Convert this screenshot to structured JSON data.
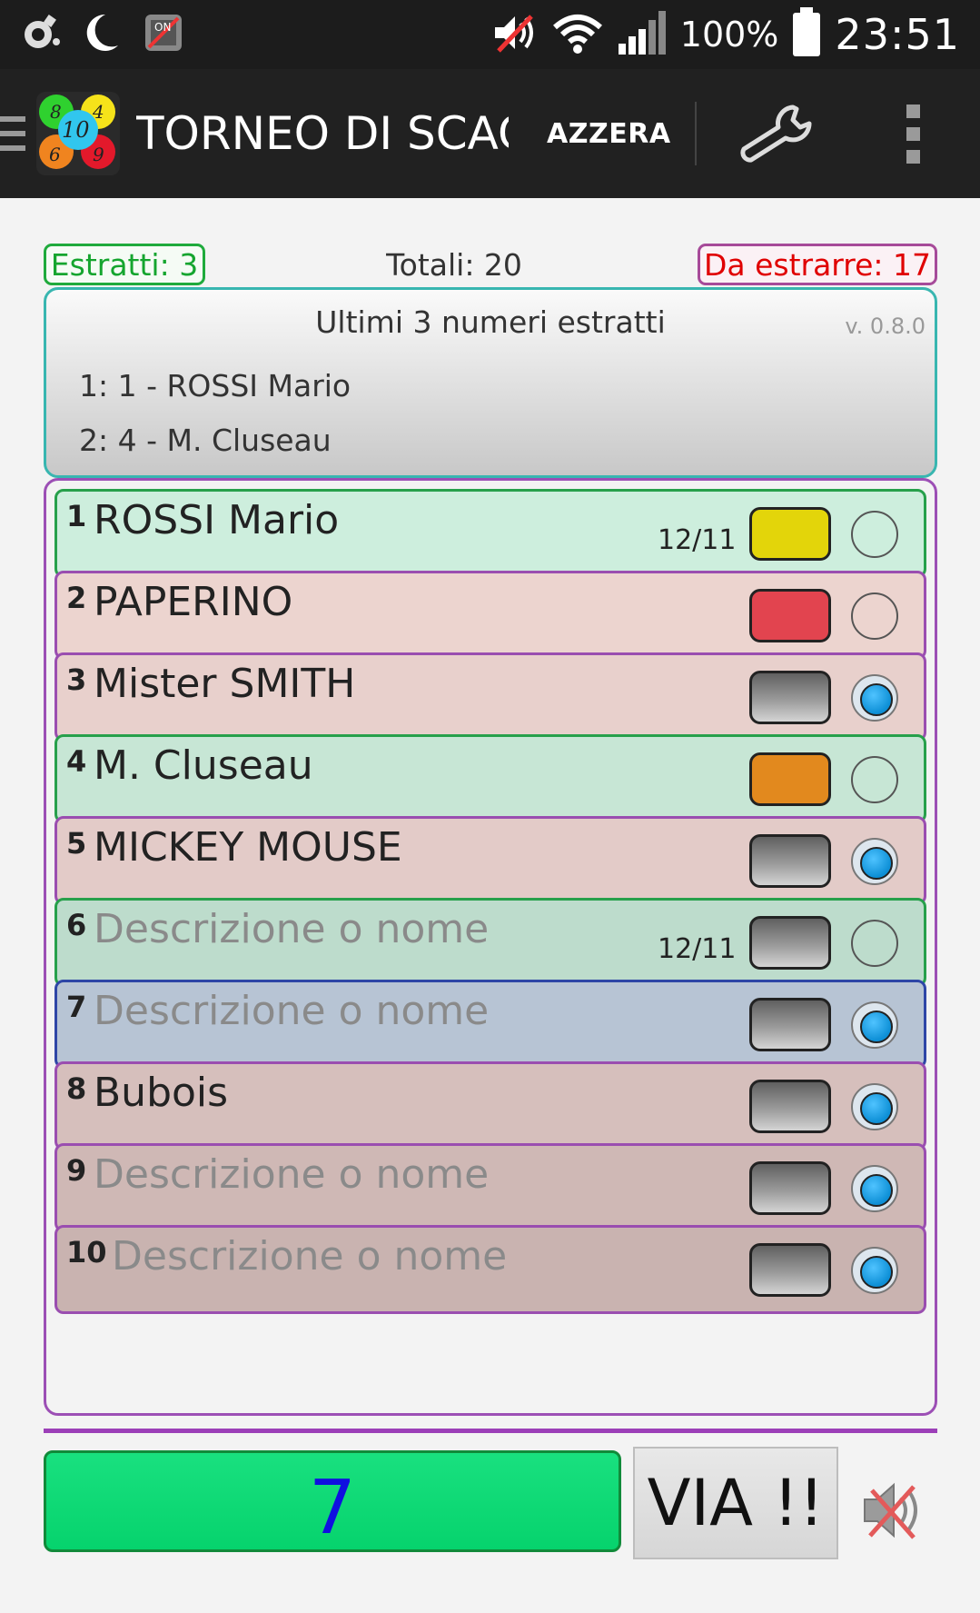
{
  "status_bar": {
    "battery": "100%",
    "time": "23:51",
    "icons": [
      "settings-satellite-icon",
      "moon-icon",
      "notification-app-icon",
      "volume-muted-icon",
      "wifi-icon",
      "signal-icon",
      "battery-icon"
    ]
  },
  "action_bar": {
    "title": "TORNEO DI SCACCHI",
    "azzera": "AZZERA",
    "logo_numbers": [
      "8",
      "4",
      "10",
      "6",
      "9"
    ]
  },
  "counters": {
    "estratti": "Estratti: 3",
    "totali": "Totali: 20",
    "da_estrarre": "Da estrarre: 17"
  },
  "last_panel": {
    "title": "Ultimi 3 numeri estratti",
    "version": "v. 0.8.0",
    "items": [
      "1: 1 - ROSSI Mario",
      "2: 4 - M. Cluseau"
    ]
  },
  "rows": [
    {
      "num": "1",
      "name": "ROSSI Mario",
      "date": "12/11",
      "color": "#e3d50a",
      "bg": "#cdeedd",
      "border": "#27a04b",
      "selected": false,
      "placeholder": false
    },
    {
      "num": "2",
      "name": "PAPERINO",
      "date": "",
      "color": "#e2444f",
      "bg": "#ecd4cf",
      "border": "#9a4eb0",
      "selected": false,
      "placeholder": false
    },
    {
      "num": "3",
      "name": "Mister SMITH",
      "date": "",
      "color": "gray",
      "bg": "#e8d0cc",
      "border": "#9a4eb0",
      "selected": true,
      "placeholder": false
    },
    {
      "num": "4",
      "name": "M. Cluseau",
      "date": "",
      "color": "#e2891e",
      "bg": "#c7e6d5",
      "border": "#27a04b",
      "selected": false,
      "placeholder": false
    },
    {
      "num": "5",
      "name": "MICKEY MOUSE",
      "date": "",
      "color": "gray",
      "bg": "#e3cbc8",
      "border": "#9a4eb0",
      "selected": true,
      "placeholder": false
    },
    {
      "num": "6",
      "name": "Descrizione o nome",
      "date": "12/11",
      "color": "gray",
      "bg": "#bddccc",
      "border": "#27a04b",
      "selected": false,
      "placeholder": true
    },
    {
      "num": "7",
      "name": "Descrizione o nome",
      "date": "",
      "color": "gray",
      "bg": "#b7c4d4",
      "border": "#2e46a6",
      "selected": true,
      "placeholder": true
    },
    {
      "num": "8",
      "name": "Bubois",
      "date": "",
      "color": "gray",
      "bg": "#d6bfbc",
      "border": "#9a4eb0",
      "selected": true,
      "placeholder": false
    },
    {
      "num": "9",
      "name": "Descrizione o nome",
      "date": "",
      "color": "gray",
      "bg": "#cfb8b5",
      "border": "#9a4eb0",
      "selected": true,
      "placeholder": true
    },
    {
      "num": "10",
      "name": "Descrizione o nome",
      "date": "",
      "color": "gray",
      "bg": "#c9b3b0",
      "border": "#9a4eb0",
      "selected": true,
      "placeholder": true
    }
  ],
  "bottom": {
    "number": "7",
    "via_label": "VIA !!"
  }
}
